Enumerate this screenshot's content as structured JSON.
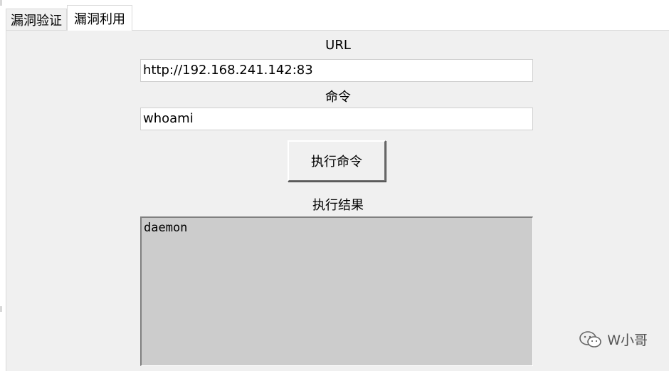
{
  "tabs": [
    {
      "label": "漏洞验证",
      "active": false
    },
    {
      "label": "漏洞利用",
      "active": true
    }
  ],
  "form": {
    "url_label": "URL",
    "url_value": "http://192.168.241.142:83",
    "cmd_label": "命令",
    "cmd_value": "whoami",
    "run_button": "执行命令",
    "result_label": "执行结果",
    "result_value": "daemon"
  },
  "watermark": {
    "text": "W小哥",
    "icon": "wechat-icon"
  },
  "colors": {
    "panel_bg": "#f0f0f0",
    "result_bg": "#cccccc",
    "entry_bg": "#ffffff"
  }
}
